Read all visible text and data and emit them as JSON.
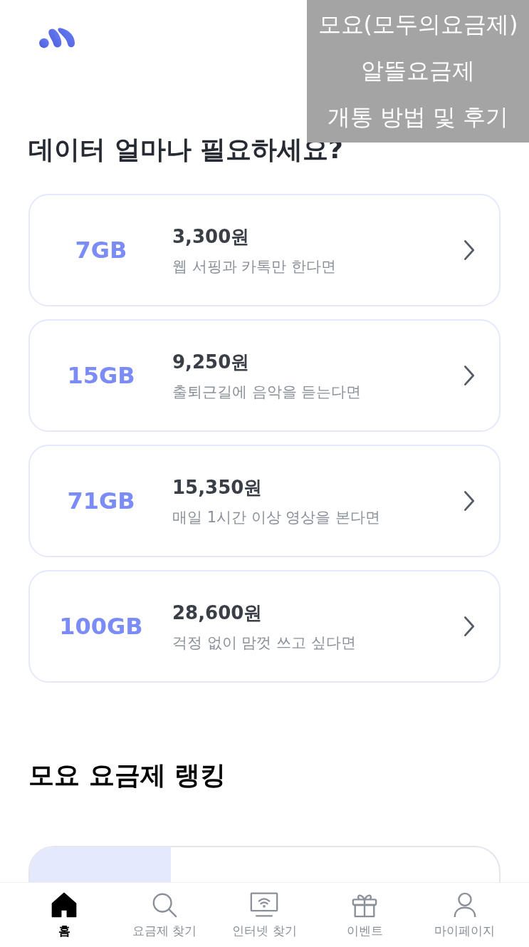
{
  "caption": {
    "lines": [
      "모요(모두의요금제)",
      "알뜰요금제",
      "개통 방법 및 후기"
    ]
  },
  "data_section": {
    "title": "데이터 얼마나 필요하세요?",
    "plans": [
      {
        "data": "7GB",
        "price": "3,300원",
        "description": "웹 서핑과 카톡만 한다면"
      },
      {
        "data": "15GB",
        "price": "9,250원",
        "description": "출퇴근길에 음악을 듣는다면"
      },
      {
        "data": "71GB",
        "price": "15,350원",
        "description": "매일 1시간 이상 영상을 본다면"
      },
      {
        "data": "100GB",
        "price": "28,600원",
        "description": "걱정 없이 맘껏 쓰고 싶다면"
      }
    ]
  },
  "ranking_section": {
    "title": "모요 요금제 랭킹"
  },
  "bottom_nav": [
    {
      "label": "홈",
      "kind": "home",
      "selected": true
    },
    {
      "label": "요금제 찾기",
      "kind": "search",
      "selected": false
    },
    {
      "label": "인터넷 찾기",
      "kind": "monitor",
      "selected": false
    },
    {
      "label": "이벤트",
      "kind": "gift",
      "selected": false
    },
    {
      "label": "마이페이지",
      "kind": "person",
      "selected": false
    }
  ]
}
